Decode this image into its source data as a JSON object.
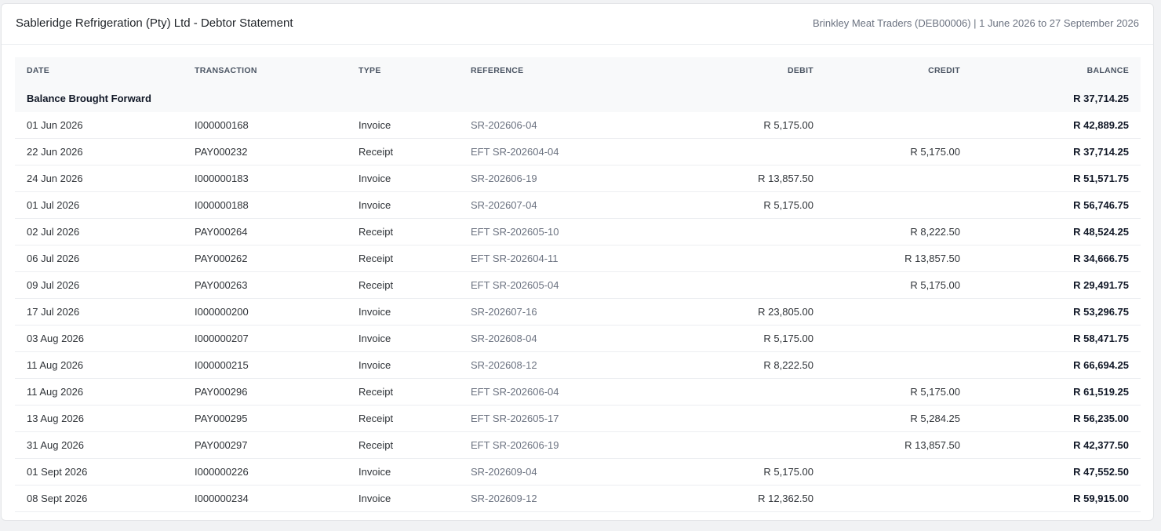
{
  "statement": {
    "title": "Sableridge Refrigeration (Pty) Ltd - Debtor Statement",
    "subtitle": "Brinkley Meat Traders (DEB00006) | 1 June 2026 to 27 September 2026"
  },
  "table": {
    "headers": {
      "date": "DATE",
      "transaction": "TRANSACTION",
      "type": "TYPE",
      "reference": "REFERENCE",
      "debit": "DEBIT",
      "credit": "CREDIT",
      "balance": "BALANCE"
    },
    "brought_forward": {
      "label": "Balance Brought Forward",
      "balance": "R 37,714.25"
    },
    "rows": [
      {
        "date": "01 Jun 2026",
        "transaction": "I000000168",
        "type": "Invoice",
        "reference": "SR-202606-04",
        "debit": "R 5,175.00",
        "credit": "",
        "balance": "R 42,889.25"
      },
      {
        "date": "22 Jun 2026",
        "transaction": "PAY000232",
        "type": "Receipt",
        "reference": "EFT SR-202604-04",
        "debit": "",
        "credit": "R 5,175.00",
        "balance": "R 37,714.25"
      },
      {
        "date": "24 Jun 2026",
        "transaction": "I000000183",
        "type": "Invoice",
        "reference": "SR-202606-19",
        "debit": "R 13,857.50",
        "credit": "",
        "balance": "R 51,571.75"
      },
      {
        "date": "01 Jul 2026",
        "transaction": "I000000188",
        "type": "Invoice",
        "reference": "SR-202607-04",
        "debit": "R 5,175.00",
        "credit": "",
        "balance": "R 56,746.75"
      },
      {
        "date": "02 Jul 2026",
        "transaction": "PAY000264",
        "type": "Receipt",
        "reference": "EFT SR-202605-10",
        "debit": "",
        "credit": "R 8,222.50",
        "balance": "R 48,524.25"
      },
      {
        "date": "06 Jul 2026",
        "transaction": "PAY000262",
        "type": "Receipt",
        "reference": "EFT SR-202604-11",
        "debit": "",
        "credit": "R 13,857.50",
        "balance": "R 34,666.75"
      },
      {
        "date": "09 Jul 2026",
        "transaction": "PAY000263",
        "type": "Receipt",
        "reference": "EFT SR-202605-04",
        "debit": "",
        "credit": "R 5,175.00",
        "balance": "R 29,491.75"
      },
      {
        "date": "17 Jul 2026",
        "transaction": "I000000200",
        "type": "Invoice",
        "reference": "SR-202607-16",
        "debit": "R 23,805.00",
        "credit": "",
        "balance": "R 53,296.75"
      },
      {
        "date": "03 Aug 2026",
        "transaction": "I000000207",
        "type": "Invoice",
        "reference": "SR-202608-04",
        "debit": "R 5,175.00",
        "credit": "",
        "balance": "R 58,471.75"
      },
      {
        "date": "11 Aug 2026",
        "transaction": "I000000215",
        "type": "Invoice",
        "reference": "SR-202608-12",
        "debit": "R 8,222.50",
        "credit": "",
        "balance": "R 66,694.25"
      },
      {
        "date": "11 Aug 2026",
        "transaction": "PAY000296",
        "type": "Receipt",
        "reference": "EFT SR-202606-04",
        "debit": "",
        "credit": "R 5,175.00",
        "balance": "R 61,519.25"
      },
      {
        "date": "13 Aug 2026",
        "transaction": "PAY000295",
        "type": "Receipt",
        "reference": "EFT SR-202605-17",
        "debit": "",
        "credit": "R 5,284.25",
        "balance": "R 56,235.00"
      },
      {
        "date": "31 Aug 2026",
        "transaction": "PAY000297",
        "type": "Receipt",
        "reference": "EFT SR-202606-19",
        "debit": "",
        "credit": "R 13,857.50",
        "balance": "R 42,377.50"
      },
      {
        "date": "01 Sept 2026",
        "transaction": "I000000226",
        "type": "Invoice",
        "reference": "SR-202609-04",
        "debit": "R 5,175.00",
        "credit": "",
        "balance": "R 47,552.50"
      },
      {
        "date": "08 Sept 2026",
        "transaction": "I000000234",
        "type": "Invoice",
        "reference": "SR-202609-12",
        "debit": "R 12,362.50",
        "credit": "",
        "balance": "R 59,915.00"
      }
    ]
  }
}
